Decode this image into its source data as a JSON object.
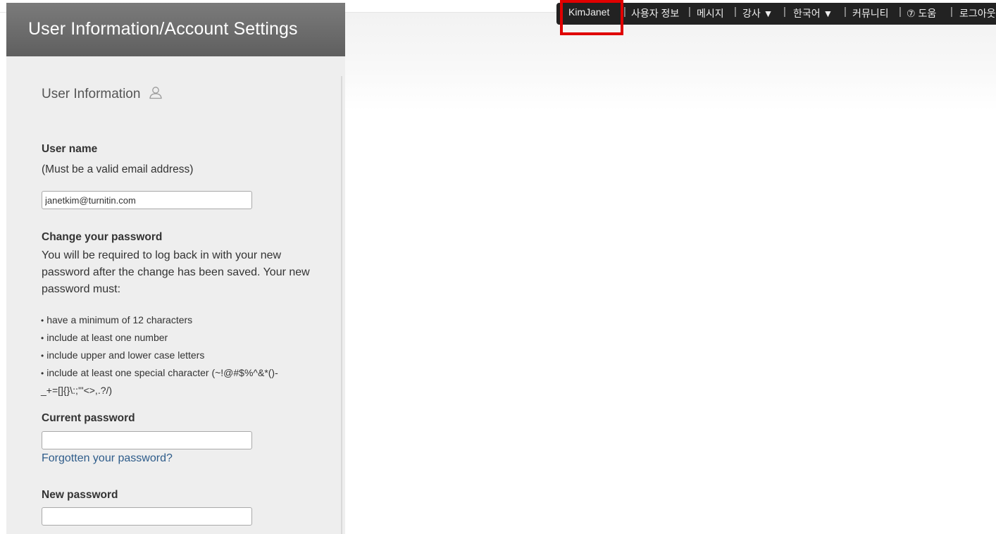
{
  "header": {
    "title": "User Information/Account Settings"
  },
  "topnav": {
    "items": [
      {
        "label": "KimJanet"
      },
      {
        "label": "사용자 정보"
      },
      {
        "label": "메시지"
      },
      {
        "label": "강사 ▼"
      },
      {
        "label": "한국어 ▼"
      },
      {
        "label": "커뮤니티"
      },
      {
        "label": "⑦ 도움"
      },
      {
        "label": "로그아웃"
      }
    ],
    "separator": "|"
  },
  "user_info": {
    "section_title": "User Information",
    "icon": "user-icon",
    "username_label": "User name",
    "username_hint": "(Must be a valid email address)",
    "username_value": "janetkim@turnitin.com"
  },
  "password": {
    "change_label": "Change your password",
    "description": "You will be required to log back in with your new password after the change has been saved. Your new password must:",
    "rules": [
      "have a minimum of 12 characters",
      "include at least one number",
      "include upper and lower case letters",
      "include at least one special character (~!@#$%^&*()-"
    ],
    "rules_continuation": "_+=[]{}\\:;'\"<>,.?/)",
    "current_label": "Current password",
    "current_value": "",
    "forgot_link": "Forgotten your password?",
    "new_label": "New password",
    "new_value": ""
  },
  "colors": {
    "header_bg": "#6b6b6b",
    "panel_bg": "#eeeeee",
    "nav_bg": "#222222",
    "highlight": "#e00000",
    "link": "#2e5c8a"
  }
}
